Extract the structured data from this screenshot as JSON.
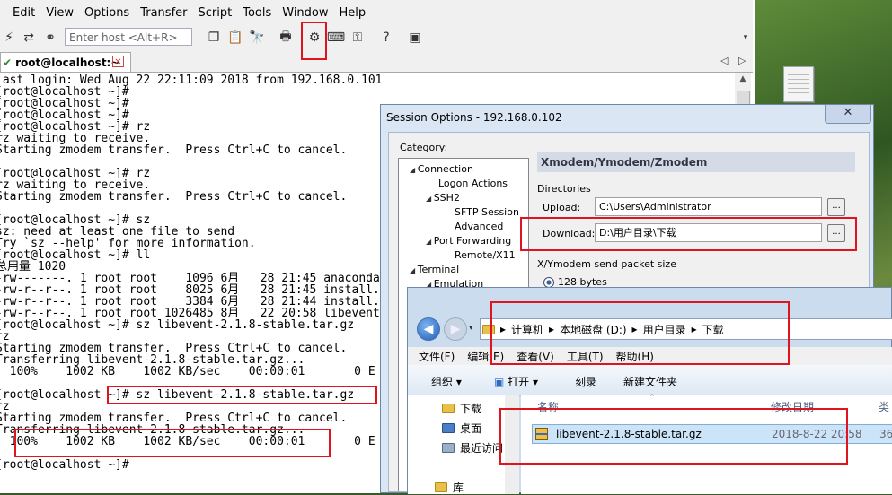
{
  "menu": [
    "Edit",
    "View",
    "Options",
    "Transfer",
    "Script",
    "Tools",
    "Window",
    "Help"
  ],
  "toolbar": {
    "host_placeholder": "Enter host <Alt+R>"
  },
  "tab": {
    "label": "root@localhost:~"
  },
  "terminal_lines": [
    "last login: Wed Aug 22 22:11:09 2018 from 192.168.0.101",
    "[root@localhost ~]#",
    "[root@localhost ~]#",
    "[root@localhost ~]#",
    "[root@localhost ~]# rz",
    "rz waiting to receive.",
    "Starting zmodem transfer.  Press Ctrl+C to cancel.",
    "",
    "[root@localhost ~]# rz",
    "rz waiting to receive.",
    "Starting zmodem transfer.  Press Ctrl+C to cancel.",
    "",
    "[root@localhost ~]# sz",
    "sz: need at least one file to send",
    "Try `sz --help' for more information.",
    "[root@localhost ~]# ll",
    "总用量 1020",
    "-rw-------. 1 root root    1096 6月   28 21:45 anaconda",
    "-rw-r--r--. 1 root root    8025 6月   28 21:45 install.",
    "-rw-r--r--. 1 root root    3384 6月   28 21:44 install.",
    "-rw-r--r--. 1 root root 1026485 8月   22 20:58 libevent",
    "[root@localhost ~]# sz libevent-2.1.8-stable.tar.gz",
    "rz",
    "Starting zmodem transfer.  Press Ctrl+C to cancel.",
    "Transferring libevent-2.1.8-stable.tar.gz...",
    "  100%    1002 KB    1002 KB/sec    00:00:01       0 E",
    "",
    "[root@localhost ~]# sz libevent-2.1.8-stable.tar.gz",
    "rz",
    "Starting zmodem transfer.  Press Ctrl+C to cancel.",
    "Transferring libevent-2.1.8-stable.tar.gz...",
    "  100%    1002 KB    1002 KB/sec    00:00:01       0 E",
    "",
    "[root@localhost ~]#"
  ],
  "dialog": {
    "title": "Session Options - 192.168.0.102",
    "close": "✕",
    "category_label": "Category:",
    "tree": [
      "Connection",
      "Logon Actions",
      "SSH2",
      "SFTP Session",
      "Advanced",
      "Port Forwarding",
      "Remote/X11",
      "Terminal",
      "Emulation"
    ],
    "panel_title": "Xmodem/Ymodem/Zmodem",
    "directories_label": "Directories",
    "upload_label": "Upload:",
    "upload_value": "C:\\Users\\Administrator",
    "download_label": "Download:",
    "download_value": "D:\\用户目录\\下载",
    "browse": "...",
    "packet_label": "X/Ymodem send packet size",
    "packet_option": "128 bytes"
  },
  "explorer": {
    "breadcrumb": [
      "计算机",
      "本地磁盘 (D:)",
      "用户目录",
      "下载"
    ],
    "menu": [
      "文件(F)",
      "编辑(E)",
      "查看(V)",
      "工具(T)",
      "帮助(H)"
    ],
    "toolbar": [
      "组织 ▾",
      "打开 ▾",
      "刻录",
      "新建文件夹"
    ],
    "nav": [
      "下载",
      "桌面",
      "最近访问",
      "库"
    ],
    "columns": [
      "名称",
      "修改日期",
      "类"
    ],
    "file": {
      "name": "libevent-2.1.8-stable.tar.gz",
      "date": "2018-8-22 20:58",
      "extra": "36"
    }
  }
}
